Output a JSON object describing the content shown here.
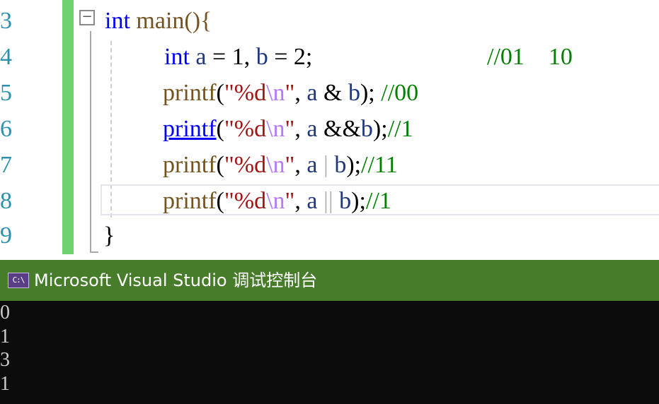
{
  "editor": {
    "line_numbers": [
      "3",
      "4",
      "5",
      "6",
      "7",
      "8",
      "9"
    ],
    "fold_symbol": "−",
    "line3": {
      "kw": "int",
      "rest": " main(){"
    },
    "line4": {
      "kw": "int",
      "a": "a",
      "eq1": " = 1, ",
      "b": "b",
      "eq2": " = 2;",
      "comment": "//01    10"
    },
    "line5": {
      "fn": "printf",
      "p1": "(",
      "str1": "\"%d",
      "esc": "\\n",
      "str2": "\"",
      "comma": ", ",
      "a": "a",
      "op": " & ",
      "b": "b",
      "close": "); ",
      "comment": "//00"
    },
    "line6": {
      "fn": "printf",
      "p1": "(",
      "str1": "\"%d",
      "esc": "\\n",
      "str2": "\"",
      "comma": ", ",
      "a": "a",
      "op": " &&",
      "b": "b",
      "close": ");",
      "comment": "//1"
    },
    "line7": {
      "fn": "printf",
      "p1": "(",
      "str1": "\"%d",
      "esc": "\\n",
      "str2": "\"",
      "comma": ", ",
      "a": "a",
      "op": " | ",
      "b": "b",
      "close": ");",
      "comment": "//11"
    },
    "line8": {
      "fn": "printf",
      "p1": "(",
      "str1": "\"%d",
      "esc": "\\n",
      "str2": "\"",
      "comma": ", ",
      "a": "a",
      "op": " || ",
      "b": "b",
      "close": ");",
      "comment": "//1"
    },
    "line9": {
      "text": "}"
    }
  },
  "console": {
    "icon_text": "C:\\",
    "title": "Microsoft Visual Studio 调试控制台",
    "output": [
      "0",
      "1",
      "3",
      "1"
    ]
  },
  "colors": {
    "keyword": "#0000ff",
    "function": "#74531f",
    "string": "#a31515",
    "escape": "#b776fb",
    "variable": "#1f377f",
    "comment": "#008000",
    "line_number": "#2b91af",
    "change_bar": "#6ed36e",
    "console_titlebar": "#477c2b",
    "console_background": "#0c0c0c"
  }
}
